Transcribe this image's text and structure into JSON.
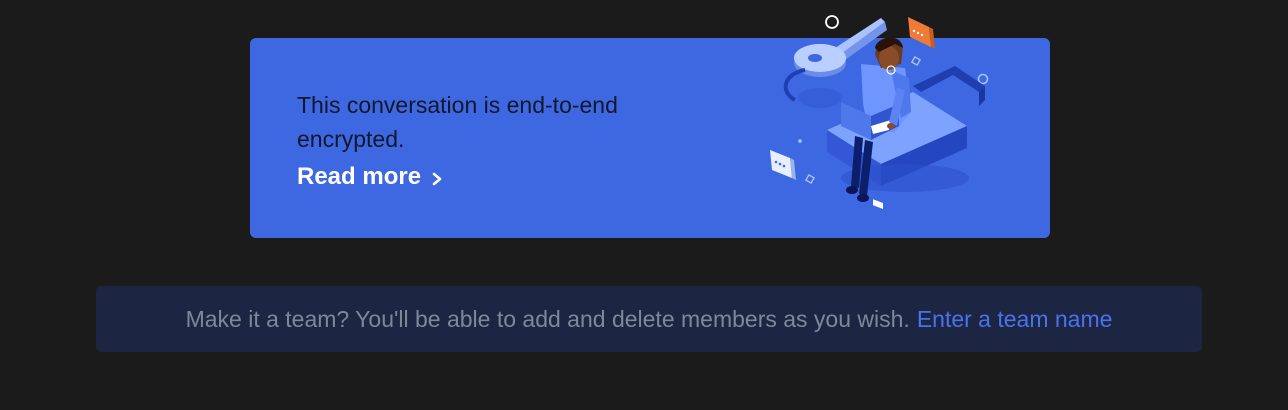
{
  "encryption_banner": {
    "message": "This conversation is end-to-end encrypted.",
    "read_more_label": "Read more",
    "chevron_icon": "chevron-right-icon",
    "illustration_icon": "encryption-illustration",
    "background_color": "#3e68e2"
  },
  "team_prompt": {
    "text": "Make it a team? You'll be able to add and delete members as you wish.",
    "link_label": "Enter a team name",
    "background_color": "#1c2541",
    "link_color": "#4a72ee"
  }
}
